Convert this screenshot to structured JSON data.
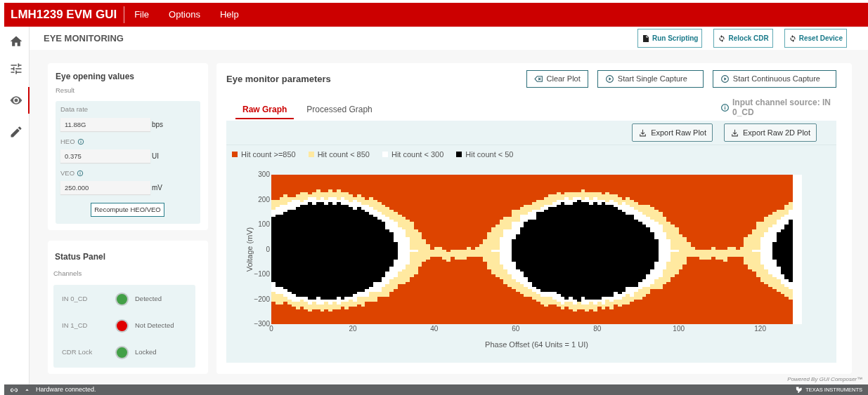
{
  "app": {
    "title": "LMH1239 EVM GUI",
    "menu": [
      "File",
      "Options",
      "Help"
    ]
  },
  "sidebar": {
    "items": [
      {
        "kind": "home",
        "selected": false
      },
      {
        "kind": "sliders",
        "selected": false
      },
      {
        "kind": "eye",
        "selected": true
      },
      {
        "kind": "pencil",
        "selected": false
      }
    ]
  },
  "page": {
    "title": "EYE MONITORING",
    "buttons": [
      {
        "label": "Run Scripting",
        "kind": "document"
      },
      {
        "label": "Relock CDR",
        "kind": "refresh"
      },
      {
        "label": "Reset Device",
        "kind": "refresh"
      }
    ]
  },
  "eye_opening": {
    "title": "Eye opening values",
    "subtitle": "Result",
    "fields": [
      {
        "label": "Data rate",
        "info": false,
        "value": "11.88G",
        "unit": "bps"
      },
      {
        "label": "HEO",
        "info": true,
        "value": "0.375",
        "unit": "UI"
      },
      {
        "label": "VEO",
        "info": true,
        "value": "250.000",
        "unit": "mV"
      }
    ],
    "button": "Recompute HEO/VEO"
  },
  "status_panel": {
    "title": "Status Panel",
    "subtitle": "Channels",
    "rows": [
      {
        "label": "IN 0_CD",
        "status": "Detected",
        "color": "#43a047"
      },
      {
        "label": "IN 1_CD",
        "status": "Not Detected",
        "color": "#e00000"
      },
      {
        "label": "CDR Lock",
        "status": "Locked",
        "color": "#43a047"
      }
    ]
  },
  "eye_monitor": {
    "title": "Eye monitor parameters",
    "buttons": [
      {
        "label": "Clear Plot",
        "kind": "clear"
      },
      {
        "label": "Start Single Capture",
        "kind": "play"
      },
      {
        "label": "Start Continuous Capture",
        "kind": "play"
      }
    ],
    "tabs": [
      {
        "label": "Raw Graph",
        "selected": true
      },
      {
        "label": "Processed Graph",
        "selected": false
      }
    ],
    "source_info": "Input channel source: IN 0_CD",
    "export_buttons": [
      "Export Raw Plot",
      "Export Raw 2D Plot"
    ],
    "legend": [
      {
        "label": "Hit count >=850",
        "color": "#dd4400"
      },
      {
        "label": "Hit count < 850",
        "color": "#ffe9a0"
      },
      {
        "label": "Hit count < 300",
        "color": "#ffffff"
      },
      {
        "label": "Hit count < 50",
        "color": "#000000"
      }
    ],
    "plot": {
      "kind": "picture",
      "ylabel": "Voltage (mV)",
      "xlabel": "Phase Offset (64 Units = 1 UI)",
      "yticks": [
        "300",
        "200",
        "100",
        "0",
        "−100",
        "−200",
        "−300"
      ],
      "xticks": [
        "0",
        "20",
        "40",
        "60",
        "80",
        "100",
        "120"
      ]
    }
  },
  "status_bar": {
    "text": "Hardware connected.",
    "powered_by": "Powered By GUI Composer™",
    "brand": "TEXAS INSTRUMENTS"
  }
}
